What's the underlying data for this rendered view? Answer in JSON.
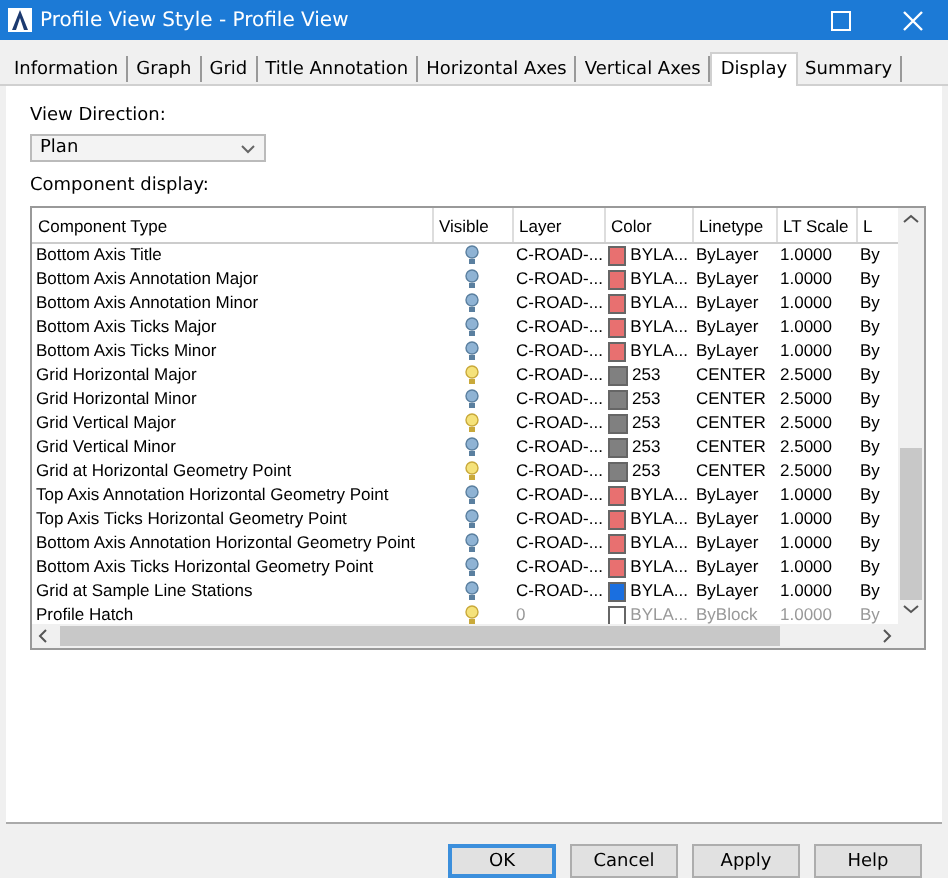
{
  "window": {
    "title": "Profile View Style - Profile View"
  },
  "tabs": [
    {
      "label": "Information",
      "selected": false
    },
    {
      "label": "Graph",
      "selected": false
    },
    {
      "label": "Grid",
      "selected": false
    },
    {
      "label": "Title Annotation",
      "selected": false
    },
    {
      "label": "Horizontal Axes",
      "selected": false
    },
    {
      "label": "Vertical Axes",
      "selected": false
    },
    {
      "label": "Display",
      "selected": true
    },
    {
      "label": "Summary",
      "selected": false
    }
  ],
  "view_direction": {
    "label": "View Direction:",
    "value": "Plan"
  },
  "component_display": {
    "label": "Component display:",
    "columns": [
      "Component Type",
      "Visible",
      "Layer",
      "Color",
      "Linetype",
      "LT Scale",
      "L"
    ],
    "rows": [
      {
        "name": "Bottom Axis Title",
        "visible": false,
        "layer": "C-ROAD-...",
        "color": "#e87070",
        "color_name": "BYLA...",
        "linetype": "ByLayer",
        "lt_scale": "1.0000",
        "column_7": "By",
        "dimmed": false
      },
      {
        "name": "Bottom Axis Annotation Major",
        "visible": false,
        "layer": "C-ROAD-...",
        "color": "#e87070",
        "color_name": "BYLA...",
        "linetype": "ByLayer",
        "lt_scale": "1.0000",
        "column_7": "By",
        "dimmed": false
      },
      {
        "name": "Bottom Axis Annotation Minor",
        "visible": false,
        "layer": "C-ROAD-...",
        "color": "#e87070",
        "color_name": "BYLA...",
        "linetype": "ByLayer",
        "lt_scale": "1.0000",
        "column_7": "By",
        "dimmed": false
      },
      {
        "name": "Bottom Axis Ticks Major",
        "visible": false,
        "layer": "C-ROAD-...",
        "color": "#e87070",
        "color_name": "BYLA...",
        "linetype": "ByLayer",
        "lt_scale": "1.0000",
        "column_7": "By",
        "dimmed": false
      },
      {
        "name": "Bottom Axis Ticks Minor",
        "visible": false,
        "layer": "C-ROAD-...",
        "color": "#e87070",
        "color_name": "BYLA...",
        "linetype": "ByLayer",
        "lt_scale": "1.0000",
        "column_7": "By",
        "dimmed": false
      },
      {
        "name": "Grid Horizontal Major",
        "visible": true,
        "layer": "C-ROAD-...",
        "color": "#808080",
        "color_name": "253",
        "linetype": "CENTER",
        "lt_scale": "2.5000",
        "column_7": "By",
        "dimmed": false
      },
      {
        "name": "Grid Horizontal Minor",
        "visible": false,
        "layer": "C-ROAD-...",
        "color": "#808080",
        "color_name": "253",
        "linetype": "CENTER",
        "lt_scale": "2.5000",
        "column_7": "By",
        "dimmed": false
      },
      {
        "name": "Grid Vertical Major",
        "visible": true,
        "layer": "C-ROAD-...",
        "color": "#808080",
        "color_name": "253",
        "linetype": "CENTER",
        "lt_scale": "2.5000",
        "column_7": "By",
        "dimmed": false
      },
      {
        "name": "Grid Vertical Minor",
        "visible": false,
        "layer": "C-ROAD-...",
        "color": "#808080",
        "color_name": "253",
        "linetype": "CENTER",
        "lt_scale": "2.5000",
        "column_7": "By",
        "dimmed": false
      },
      {
        "name": "Grid at Horizontal Geometry Point",
        "visible": true,
        "layer": "C-ROAD-...",
        "color": "#808080",
        "color_name": "253",
        "linetype": "CENTER",
        "lt_scale": "2.5000",
        "column_7": "By",
        "dimmed": false
      },
      {
        "name": "Top Axis Annotation Horizontal Geometry Point",
        "visible": false,
        "layer": "C-ROAD-...",
        "color": "#e87070",
        "color_name": "BYLA...",
        "linetype": "ByLayer",
        "lt_scale": "1.0000",
        "column_7": "By",
        "dimmed": false
      },
      {
        "name": "Top Axis Ticks Horizontal Geometry Point",
        "visible": false,
        "layer": "C-ROAD-...",
        "color": "#e87070",
        "color_name": "BYLA...",
        "linetype": "ByLayer",
        "lt_scale": "1.0000",
        "column_7": "By",
        "dimmed": false
      },
      {
        "name": "Bottom Axis Annotation Horizontal Geometry Point",
        "visible": false,
        "layer": "C-ROAD-...",
        "color": "#e87070",
        "color_name": "BYLA...",
        "linetype": "ByLayer",
        "lt_scale": "1.0000",
        "column_7": "By",
        "dimmed": false
      },
      {
        "name": "Bottom Axis Ticks Horizontal Geometry Point",
        "visible": false,
        "layer": "C-ROAD-...",
        "color": "#e87070",
        "color_name": "BYLA...",
        "linetype": "ByLayer",
        "lt_scale": "1.0000",
        "column_7": "By",
        "dimmed": false
      },
      {
        "name": "Grid at Sample Line Stations",
        "visible": false,
        "layer": "C-ROAD-...",
        "color": "#1a6fe0",
        "color_name": "BYLA...",
        "linetype": "ByLayer",
        "lt_scale": "1.0000",
        "column_7": "By",
        "dimmed": false
      },
      {
        "name": "Profile Hatch",
        "visible": true,
        "layer": "0",
        "color": "#ffffff",
        "color_name": "BYLA...",
        "linetype": "ByBlock",
        "lt_scale": "1.0000",
        "column_7": "By",
        "dimmed": true
      }
    ]
  },
  "buttons": [
    {
      "label": "OK",
      "default": true
    },
    {
      "label": "Cancel",
      "default": false
    },
    {
      "label": "Apply",
      "default": false
    },
    {
      "label": "Help",
      "default": false
    }
  ]
}
